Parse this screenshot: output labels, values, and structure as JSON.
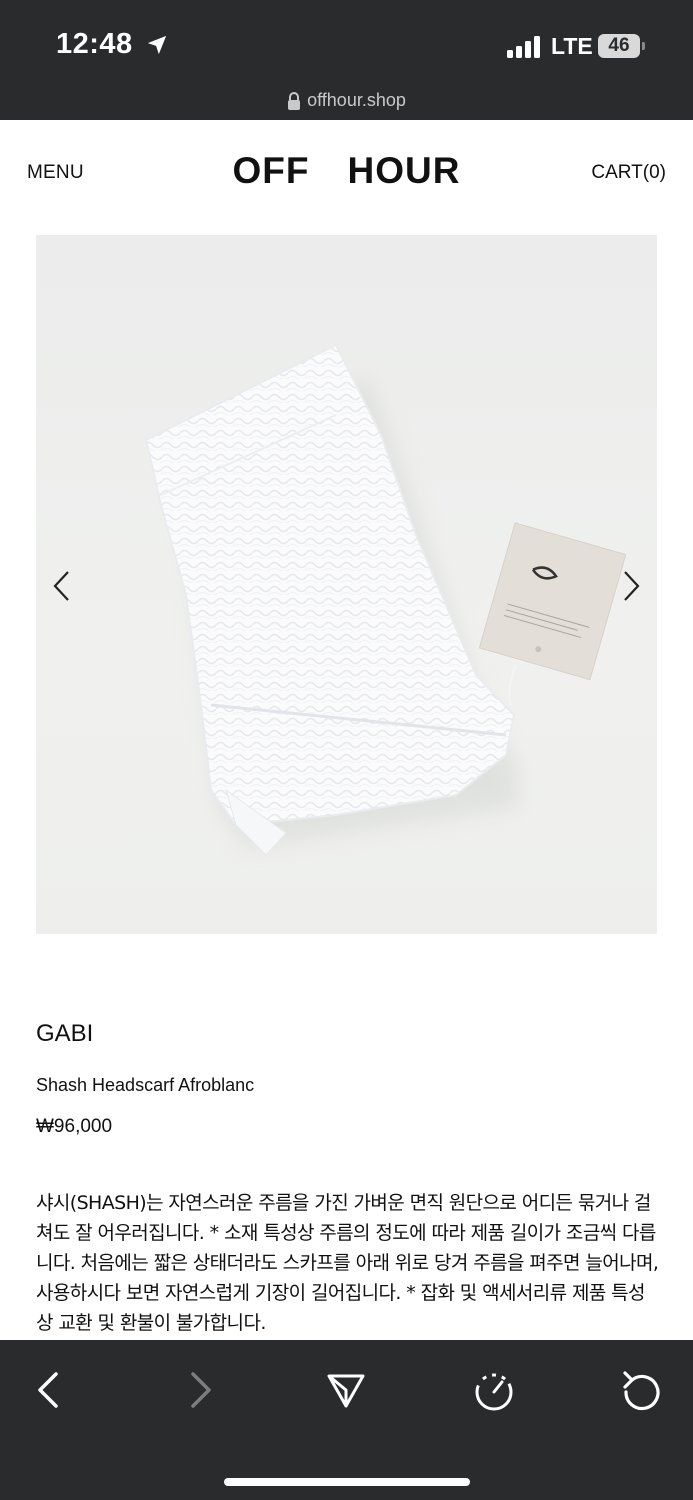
{
  "status_bar": {
    "time": "12:48",
    "network": "LTE",
    "battery": "46",
    "location_icon": "location-arrow-icon",
    "signal_icon": "signal-bars-icon"
  },
  "browser": {
    "url": "offhour.shop",
    "lock_icon": "lock-icon"
  },
  "header": {
    "menu_label": "MENU",
    "logo_word1": "OFF",
    "logo_word2": "HOUR",
    "cart_label": "CART(0)"
  },
  "gallery": {
    "prev_icon": "chevron-left-icon",
    "next_icon": "chevron-right-icon",
    "image_subject": "white textured scarf with beige tag"
  },
  "product": {
    "brand": "GABI",
    "name": "Shash Headscarf Afroblanc",
    "price": "₩96,000",
    "description": "샤시(SHASH)는 자연스러운 주름을 가진 가벼운 면직 원단으로 어디든 묶거나 걸쳐도 잘 어우러집니다. * 소재 특성상 주름의 정도에 따라 제품 길이가 조금씩 다릅니다. 처음에는 짧은 상태더라도 스카프를 아래 위로 당겨 주름을 펴주면 늘어나며, 사용하시다 보면 자연스럽게 기장이 길어집니다. * 잡화 및 액세서리류 제품 특성상 교환 및 환불이 불가합니다."
  },
  "toolbar": {
    "back_icon": "back-chevron-icon",
    "forward_icon": "forward-chevron-icon",
    "share_icon": "send-icon",
    "timer_icon": "timer-icon",
    "reload_icon": "reload-icon"
  },
  "colors": {
    "chrome_bg": "#2a2b2d",
    "page_bg": "#ffffff",
    "text": "#111111"
  }
}
